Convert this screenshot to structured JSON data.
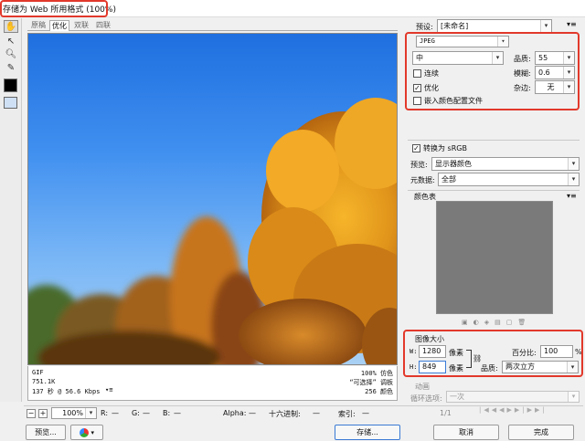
{
  "window": {
    "title": "存储为 Web 所用格式 (100%)"
  },
  "tabs": [
    "原稿",
    "优化",
    "双联",
    "四联"
  ],
  "active_tab": 1,
  "tools": {
    "hand_icon": "hand-icon",
    "slice_select_icon": "slice-select-icon",
    "zoom_icon": "zoom-icon",
    "eyedropper_icon": "eyedropper-icon",
    "color_swatch": "#000000",
    "toggle_slices_icon": "toggle-slices-icon"
  },
  "preview_info": {
    "format": "GIF",
    "size": "751.1K",
    "time": "137 秒 @ 56.6 Kbps",
    "dither_pct": "100% 仿色",
    "palette": "“可选择” 调板",
    "colors": "256 颜色"
  },
  "bottom_bar": {
    "zoom": "100%",
    "r_label": "R:",
    "r_value": "—",
    "g_label": "G:",
    "g_value": "—",
    "b_label": "B:",
    "b_value": "—",
    "alpha_label": "Alpha:",
    "alpha_value": "—",
    "hex_label": "十六进制:",
    "hex_value": "—",
    "index_label": "索引:",
    "index_value": "—"
  },
  "buttons": {
    "preview": "预览...",
    "save": "存储...",
    "cancel": "取消",
    "done": "完成"
  },
  "settings": {
    "preset_label": "预设:",
    "preset_value": "[未命名]",
    "format": "JPEG",
    "quality_level": "中",
    "quality_label": "品质:",
    "quality_value": "55",
    "progressive_label": "连续",
    "progressive_checked": false,
    "blur_label": "模糊:",
    "blur_value": "0.6",
    "optimized_label": "优化",
    "optimized_checked": true,
    "matte_label": "杂边:",
    "matte_value": "无",
    "icc_label": "嵌入颜色配置文件",
    "icc_checked": false,
    "srgb_label": "转换为 sRGB",
    "srgb_checked": true,
    "preview_label": "预览:",
    "preview_value": "显示器颜色",
    "metadata_label": "元数据:",
    "metadata_value": "全部"
  },
  "color_table": {
    "title": "颜色表",
    "swatch_color": "#7a7a7a"
  },
  "image_size": {
    "title": "图像大小",
    "w_label": "W:",
    "w_value": "1280",
    "h_label": "H:",
    "h_value": "849",
    "unit": "像素",
    "percent_label": "百分比:",
    "percent_value": "100",
    "percent_unit": "%",
    "quality_label": "品质:",
    "quality_value": "两次立方"
  },
  "animation": {
    "title": "动画",
    "loop_label": "循环选项:",
    "loop_value": "一次",
    "frame": "1/1"
  },
  "accent": "#e2392b"
}
